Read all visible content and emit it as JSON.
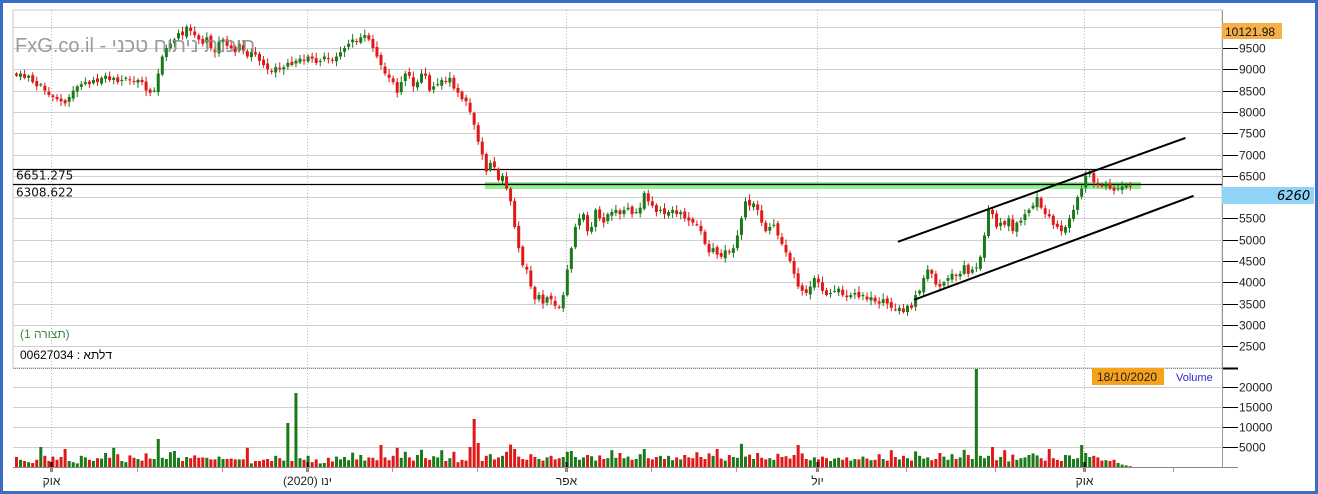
{
  "watermark": "FxG.co.il - תוכנת ניתוח טכני",
  "config_label": "(תצורה 1)",
  "delta_label": "00627034 : דלתא",
  "colors": {
    "up": "#1a7a1a",
    "down": "#e01818",
    "band": "#8ef08e",
    "frame": "#3b6dc2",
    "last_price_bg": "#8fd3f7",
    "high_bg": "#f6b04a",
    "date_bg": "#f6a21a",
    "volume_label": "#2a2acf"
  },
  "chart_data": {
    "type": "candlestick",
    "title": "",
    "price_axis": {
      "ylim": [
        2000,
        10400
      ],
      "ticks": [
        9500,
        9000,
        8500,
        8000,
        7500,
        7000,
        6500,
        6000,
        5500,
        5000,
        4500,
        4000,
        3500,
        3000,
        2500
      ]
    },
    "volume_axis": {
      "label": "Volume",
      "ylim": [
        0,
        20000
      ],
      "ticks": [
        20000,
        15000,
        10000,
        5000
      ]
    },
    "high_label": "10121.98",
    "last_price_label": "6260",
    "last_date_label": "18/10/2020",
    "x_labels": [
      {
        "index": 9,
        "label": "אוק"
      },
      {
        "index": 72,
        "label": "ינו (2020)"
      },
      {
        "index": 136,
        "label": "אפר"
      },
      {
        "index": 198,
        "label": "יול"
      },
      {
        "index": 264,
        "label": "אוק"
      }
    ],
    "month_ticks": [
      9,
      30,
      51,
      72,
      93,
      114,
      136,
      157,
      178,
      198,
      220,
      242,
      264,
      286
    ],
    "horizontal_levels": [
      {
        "value": 6651.275,
        "label": "6651.275"
      },
      {
        "value": 6308.622,
        "label": "6308.622"
      }
    ],
    "support_band": {
      "from_index": 116,
      "to_index": 278,
      "low": 6190,
      "high": 6330
    },
    "channel_lines": [
      {
        "name": "upper",
        "start": [
          218,
          4950
        ],
        "end": [
          289,
          7390
        ]
      },
      {
        "name": "lower",
        "start": [
          222,
          3590
        ],
        "end": [
          291,
          6030
        ]
      }
    ],
    "closes": [
      8850,
      8900,
      8800,
      8850,
      8700,
      8600,
      8650,
      8500,
      8400,
      8350,
      8300,
      8250,
      8200,
      8350,
      8500,
      8600,
      8650,
      8700,
      8650,
      8750,
      8700,
      8800,
      8850,
      8750,
      8800,
      8700,
      8750,
      8800,
      8750,
      8700,
      8750,
      8700,
      8500,
      8450,
      8500,
      8900,
      9300,
      9500,
      9600,
      9700,
      9850,
      9800,
      10000,
      9900,
      9800,
      9700,
      9600,
      9750,
      9500,
      9400,
      9650,
      9700,
      9550,
      9500,
      9400,
      9600,
      9450,
      9300,
      9400,
      9350,
      9200,
      9100,
      9000,
      8950,
      9050,
      9000,
      9050,
      9150,
      9100,
      9200,
      9250,
      9200,
      9300,
      9250,
      9150,
      9200,
      9300,
      9250,
      9200,
      9300,
      9400,
      9500,
      9600,
      9700,
      9650,
      9750,
      9800,
      9700,
      9500,
      9300,
      9100,
      8900,
      8800,
      8700,
      8450,
      8700,
      8900,
      8850,
      8600,
      8700,
      8900,
      8850,
      8500,
      8600,
      8650,
      8750,
      8700,
      8800,
      8550,
      8450,
      8300,
      8250,
      8000,
      7700,
      7300,
      7000,
      6600,
      6800,
      6700,
      6400,
      6500,
      6200,
      5900,
      5300,
      4800,
      4400,
      4300,
      3900,
      3600,
      3700,
      3500,
      3650,
      3600,
      3450,
      3400,
      3700,
      4300,
      4800,
      5300,
      5500,
      5600,
      5200,
      5300,
      5700,
      5500,
      5400,
      5600,
      5650,
      5700,
      5600,
      5700,
      5750,
      5600,
      5650,
      5750,
      6100,
      5900,
      5800,
      5650,
      5700,
      5600,
      5650,
      5700,
      5600,
      5650,
      5500,
      5450,
      5400,
      5350,
      5200,
      4900,
      4700,
      4800,
      4650,
      4600,
      4750,
      4700,
      4800,
      5100,
      5500,
      5900,
      5800,
      5850,
      5700,
      5400,
      5200,
      5300,
      5350,
      5100,
      4900,
      4700,
      4500,
      4200,
      3900,
      3800,
      3750,
      3900,
      4100,
      4000,
      3800,
      3700,
      3750,
      3800,
      3850,
      3700,
      3650,
      3700,
      3750,
      3650,
      3700,
      3600,
      3650,
      3550,
      3500,
      3600,
      3500,
      3400,
      3350,
      3400,
      3300,
      3450,
      3400,
      3700,
      3800,
      4100,
      4300,
      4200,
      3950,
      3900,
      4000,
      4100,
      4200,
      4150,
      4200,
      4400,
      4200,
      4300,
      4350,
      4600,
      5100,
      5700,
      5600,
      5300,
      5400,
      5350,
      5500,
      5200,
      5400,
      5450,
      5600,
      5700,
      5800,
      6000,
      5750,
      5600,
      5550,
      5350,
      5300,
      5200,
      5300,
      5500,
      5700,
      6000,
      6200,
      6500,
      6600,
      6350,
      6300,
      6250,
      6300,
      6200,
      6150,
      6200,
      6250,
      6280,
      6260
    ],
    "volumes": [
      2500,
      1800,
      1500,
      1200,
      1000,
      1800,
      5000,
      2800,
      1500,
      2600,
      1800,
      2500,
      4500,
      1500,
      1200,
      900,
      2800,
      2400,
      1800,
      1500,
      2200,
      2100,
      3500,
      2300,
      4800,
      3200,
      1500,
      1200,
      2900,
      2300,
      2000,
      1600,
      3400,
      2100,
      2000,
      7000,
      2300,
      2000,
      3700,
      4000,
      2300,
      1500,
      2500,
      2200,
      2900,
      2300,
      2400,
      2300,
      1900,
      1900,
      2600,
      2000,
      2000,
      2100,
      1900,
      1900,
      1900,
      4800,
      900,
      1500,
      1500,
      1800,
      2000,
      1500,
      2800,
      2200,
      1600,
      11000,
      1500,
      18500,
      2200,
      1800,
      2800,
      1200,
      1900,
      900,
      1000,
      2300,
      1400,
      2600,
      1900,
      2500,
      1700,
      3600,
      1900,
      3000,
      1600,
      2400,
      2300,
      1700,
      5500,
      2400,
      1700,
      2800,
      4800,
      2300,
      3800,
      2400,
      1600,
      3000,
      4300,
      2200,
      1800,
      2700,
      2400,
      4200,
      1500,
      2200,
      3800,
      1200,
      1800,
      1600,
      5000,
      12000,
      6000,
      1500,
      2800,
      3200,
      1900,
      2400,
      2800,
      3800,
      5600,
      4500,
      2600,
      2000,
      1800,
      3200,
      2500,
      2000,
      1600,
      2400,
      2800,
      1900,
      2200,
      2500,
      3800,
      4000,
      2500,
      1800,
      2400,
      3000,
      2700,
      1600,
      2900,
      2000,
      2200,
      4200,
      2300,
      3500,
      2200,
      2600,
      1800,
      2000,
      3200,
      4500,
      2200,
      1900,
      2500,
      2800,
      2000,
      2800,
      1700,
      2400,
      1900,
      3000,
      2400,
      2200,
      3700,
      2500,
      2000,
      3400,
      2800,
      4500,
      2100,
      1600,
      3000,
      2500,
      2300,
      5800,
      2600,
      3100,
      2000,
      3500,
      2300,
      1900,
      2200,
      1800,
      3300,
      2500,
      2700,
      2100,
      3000,
      5500,
      3400,
      2000,
      1700,
      2400,
      1900,
      2600,
      2200,
      1500,
      2100,
      2300,
      1800,
      2400,
      1600,
      2000,
      1900,
      2600,
      2100,
      1700,
      1800,
      3200,
      2000,
      1600,
      4200,
      2500,
      1900,
      2800,
      2200,
      1600,
      3900,
      2800,
      2100,
      2400,
      1700,
      2000,
      3500,
      2600,
      1800,
      3200,
      2000,
      2400,
      4300,
      3000,
      2000,
      25000,
      2800,
      2200,
      2800,
      5000,
      1700,
      2500,
      4200,
      1400,
      3100,
      1800,
      2200,
      2400,
      3000,
      3400,
      2900,
      2200,
      1600,
      4500,
      2200,
      1800,
      1500,
      3000,
      2900,
      2000,
      2200,
      5500,
      3500,
      2500,
      2800,
      2400,
      1600,
      1700,
      1500,
      1800,
      1000,
      600,
      400,
      200
    ]
  }
}
